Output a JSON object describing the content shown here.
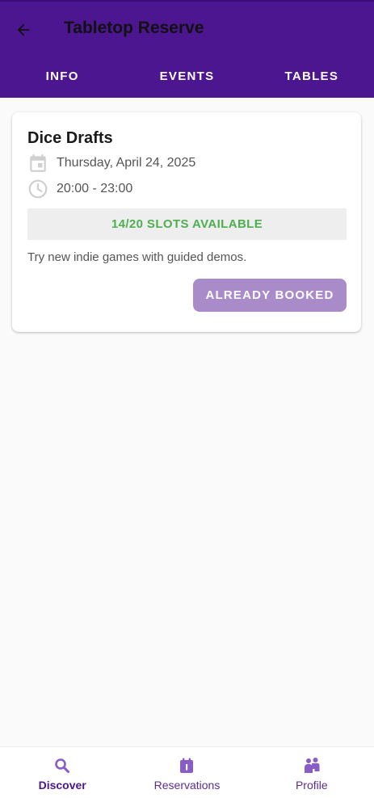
{
  "app": {
    "title": "Tabletop Reserve"
  },
  "tabs": [
    {
      "label": "INFO"
    },
    {
      "label": "EVENTS"
    },
    {
      "label": "TABLES"
    }
  ],
  "event": {
    "title": "Dice Drafts",
    "date": "Thursday, April 24, 2025",
    "time": "20:00 - 23:00",
    "slots": "14/20 SLOTS AVAILABLE",
    "description": "Try new indie games with guided demos.",
    "button_label": "ALREADY BOOKED"
  },
  "bottom_nav": [
    {
      "label": "Discover",
      "icon": "search-icon",
      "active": true
    },
    {
      "label": "Reservations",
      "icon": "calendar-icon",
      "active": false
    },
    {
      "label": "Profile",
      "icon": "people-icon",
      "active": false
    }
  ],
  "colors": {
    "app_bar": "#4c1690",
    "accent": "#5b2c97",
    "slots_text": "#4caf50",
    "disabled_button": "#a98bc9"
  }
}
